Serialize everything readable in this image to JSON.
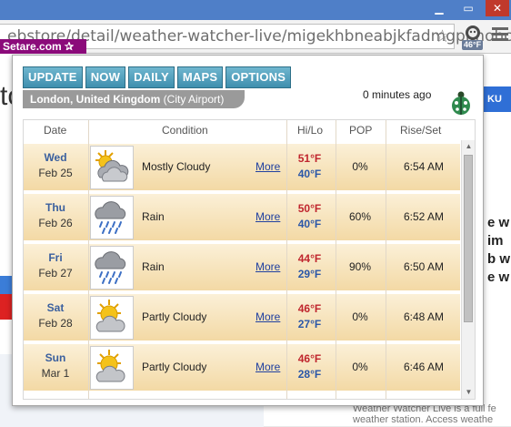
{
  "browser": {
    "url": "ebstore/detail/weather-watcher-live/migekhbneabjkfadmgpimohcoc",
    "extension_badge": "46°F",
    "overlay_brand": "Setare.com"
  },
  "page": {
    "title_fragment": "tch",
    "button_fragment": "KU",
    "text_fragment": "e w\nim\nb w\ne w",
    "footer_fragment": "Weather Watcher Live is a full fe\nweather station. Access weathe"
  },
  "popup": {
    "tabs": [
      "UPDATE",
      "NOW",
      "DAILY",
      "MAPS",
      "OPTIONS"
    ],
    "location_bold": "London, United Kingdom",
    "location_rest": "(City Airport)",
    "updated": "0 minutes ago",
    "columns": [
      "Date",
      "Condition",
      "Hi/Lo",
      "POP",
      "Rise/Set"
    ],
    "more_label": "More",
    "rows": [
      {
        "day": "Wed",
        "date": "Feb 25",
        "icon": "mostly-cloudy-icon",
        "condition": "Mostly Cloudy",
        "hi": "51°F",
        "lo": "40°F",
        "pop": "0%",
        "rise": "6:54 AM"
      },
      {
        "day": "Thu",
        "date": "Feb 26",
        "icon": "rain-icon",
        "condition": "Rain",
        "hi": "50°F",
        "lo": "40°F",
        "pop": "60%",
        "rise": "6:52 AM"
      },
      {
        "day": "Fri",
        "date": "Feb 27",
        "icon": "rain-icon",
        "condition": "Rain",
        "hi": "44°F",
        "lo": "29°F",
        "pop": "90%",
        "rise": "6:50 AM"
      },
      {
        "day": "Sat",
        "date": "Feb 28",
        "icon": "partly-cloudy-icon",
        "condition": "Partly Cloudy",
        "hi": "46°F",
        "lo": "27°F",
        "pop": "0%",
        "rise": "6:48 AM"
      },
      {
        "day": "Sun",
        "date": "Mar 1",
        "icon": "partly-cloudy-icon",
        "condition": "Partly Cloudy",
        "hi": "46°F",
        "lo": "28°F",
        "pop": "0%",
        "rise": "6:46 AM"
      }
    ]
  },
  "colors": {
    "tab_blue": "#3f8fae",
    "row_gold": "#f3d9a5",
    "hi_red": "#c0262e",
    "lo_blue": "#2b57a8"
  }
}
